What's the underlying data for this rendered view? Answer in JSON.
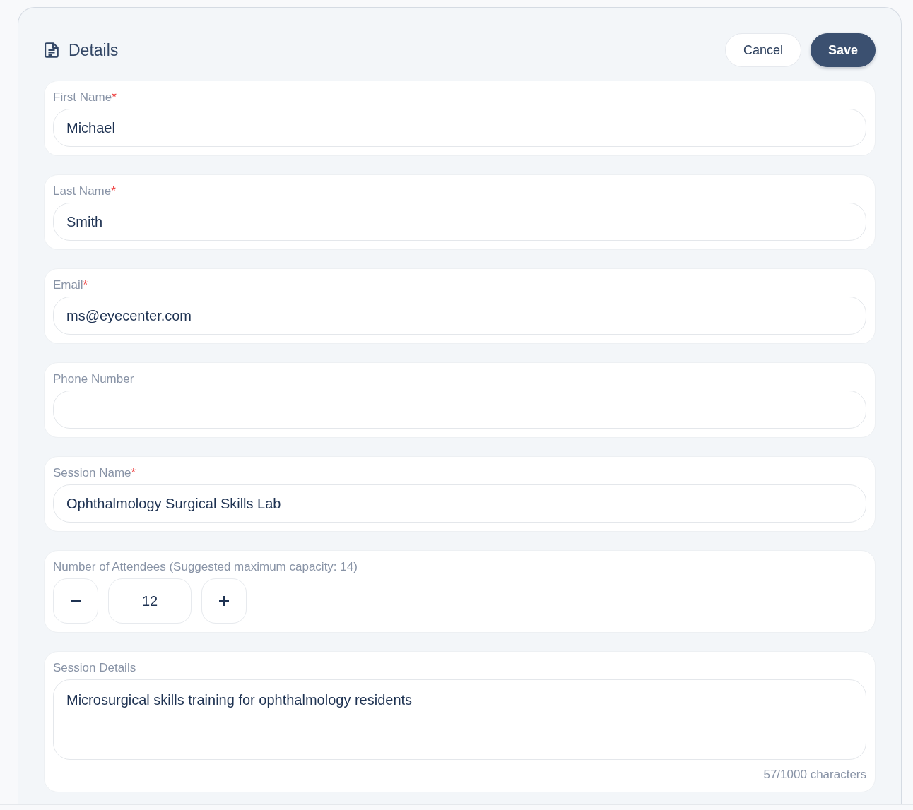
{
  "header": {
    "title": "Details",
    "buttons": [
      {
        "label": "Cancel",
        "kind": "secondary"
      },
      {
        "label": "Save",
        "kind": "primary"
      }
    ]
  },
  "fields": [
    {
      "kind": "text",
      "label": "First Name",
      "required_mark": "*",
      "value": "Michael"
    },
    {
      "kind": "text",
      "label": "Last Name",
      "required_mark": "*",
      "value": "Smith"
    },
    {
      "kind": "text",
      "label": "Email",
      "required_mark": "*",
      "value": "ms@eyecenter.com"
    },
    {
      "kind": "text",
      "label": "Phone Number"
    },
    {
      "kind": "text",
      "label": "Session Name",
      "required_mark": "*",
      "value": "Ophthalmology Surgical Skills Lab"
    },
    {
      "kind": "stepper",
      "label": "Number of Attendees (Suggested maximum capacity: 14)",
      "value": "12"
    },
    {
      "kind": "textarea",
      "label": "Session Details",
      "value": "Microsurgical skills training for ophthalmology residents",
      "counter": "57/1000 characters"
    }
  ]
}
